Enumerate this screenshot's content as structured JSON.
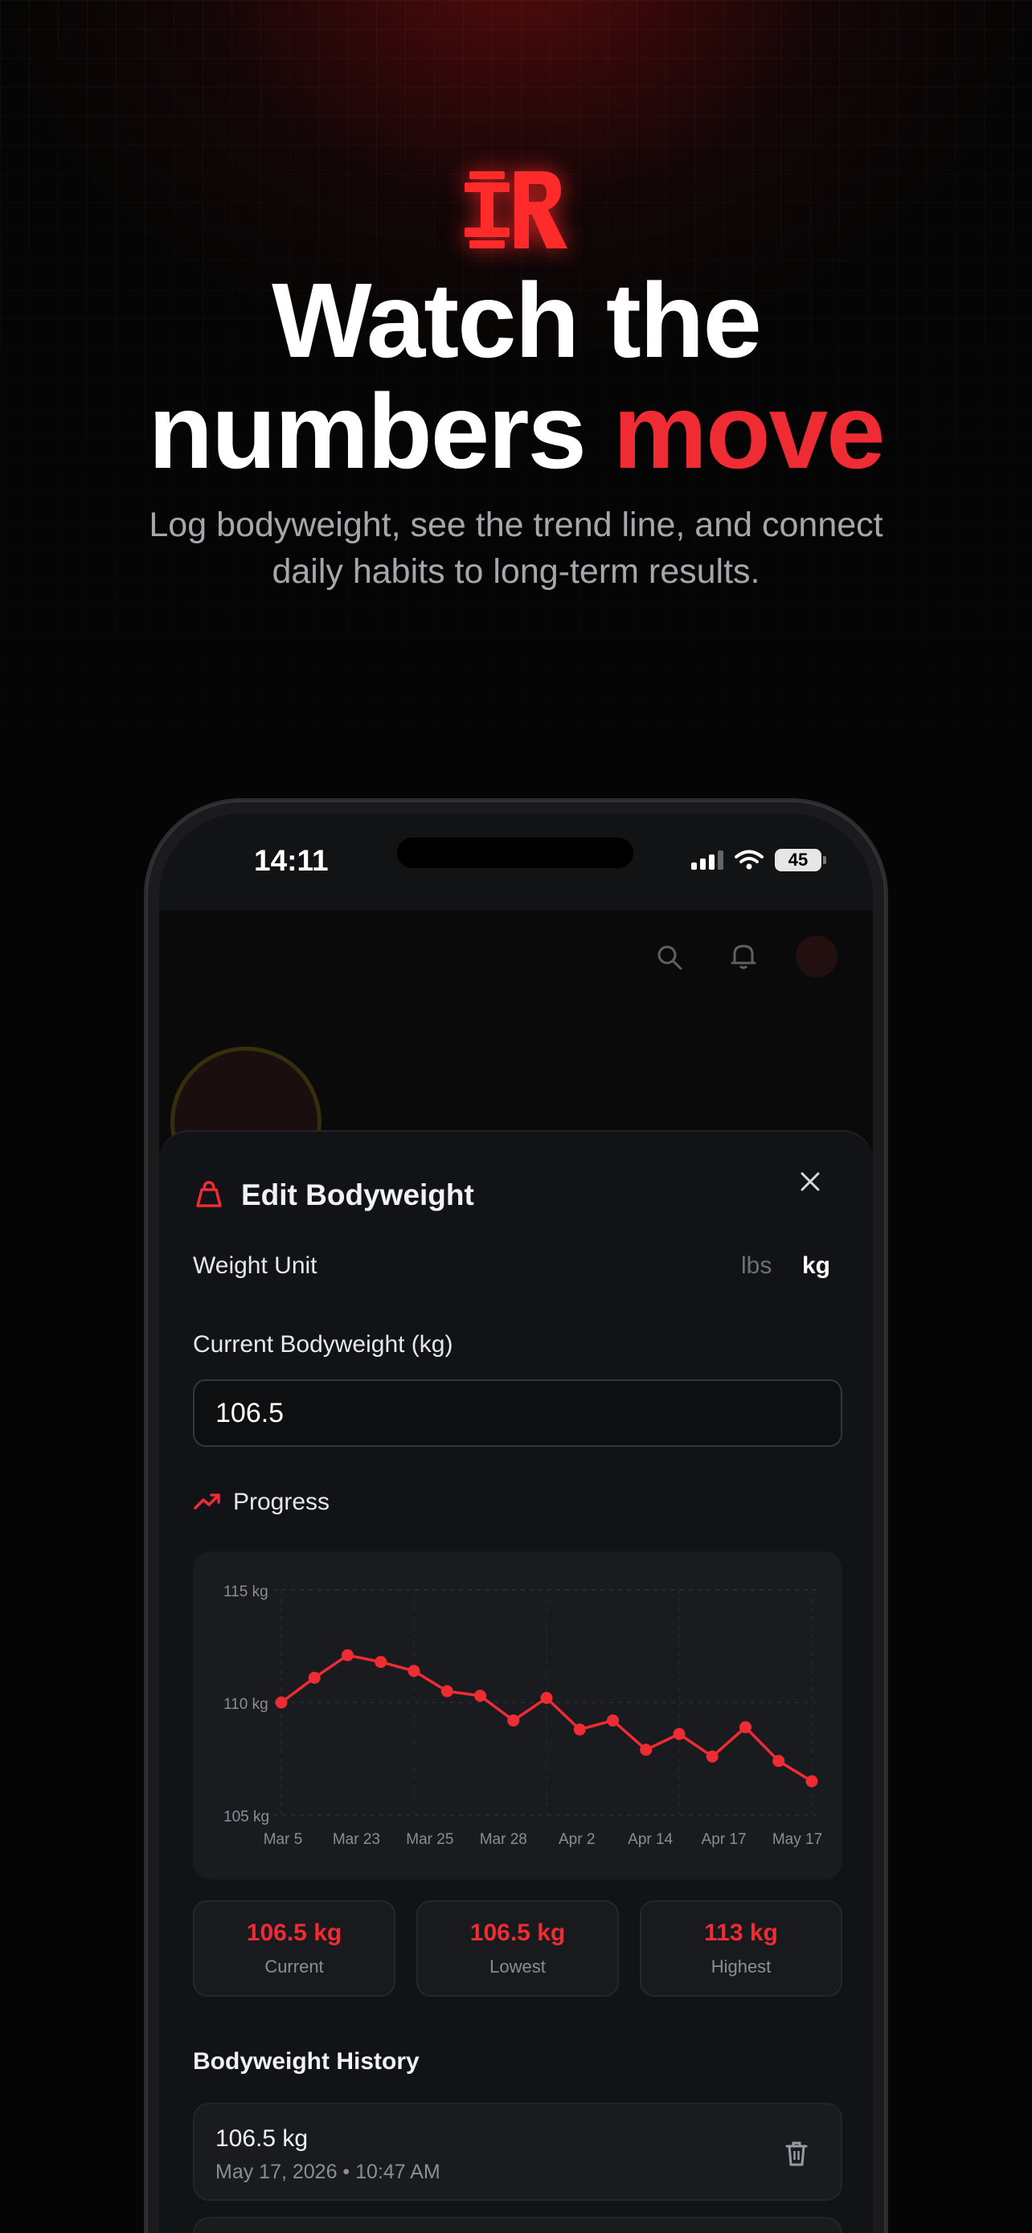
{
  "hero": {
    "title_line1": "Watch the",
    "title_line2_white": "numbers ",
    "title_line2_accent": "move",
    "subtitle_line1": "Log bodyweight, see the trend line, and connect",
    "subtitle_line2": "daily habits to long-term results."
  },
  "status_bar": {
    "time": "14:11",
    "battery": "45"
  },
  "colors": {
    "accent": "#ef2b33",
    "background": "#050505",
    "sheet": "#121316",
    "card": "#1a1b1f",
    "muted": "#8c8d94"
  },
  "icons": [
    "barbell-logo-icon",
    "search-icon",
    "bell-icon",
    "weight-icon",
    "close-icon",
    "trending-up-icon",
    "trash-icon"
  ],
  "sheet": {
    "title": "Edit Bodyweight",
    "weight_unit_label": "Weight Unit",
    "unit_lbs": "lbs",
    "unit_kg": "kg",
    "selected_unit": "kg",
    "current_label": "Current Bodyweight (kg)",
    "current_value": "106.5",
    "progress_label": "Progress"
  },
  "chart_data": {
    "type": "line",
    "title": "",
    "xlabel": "",
    "ylabel": "",
    "ylim": [
      105,
      115
    ],
    "yticks": [
      "115 kg",
      "110 kg",
      "105 kg"
    ],
    "xtick_labels": [
      "Mar 5",
      "Mar 23",
      "Mar 25",
      "Mar 28",
      "Apr 2",
      "Apr 14",
      "Apr 17",
      "May 17"
    ],
    "series": [
      {
        "values": [
          110.0,
          111.1,
          112.1,
          111.8,
          111.4,
          110.5,
          110.3,
          109.2,
          110.2,
          108.8,
          109.2,
          107.9,
          108.6,
          107.6,
          108.9,
          107.4,
          106.5
        ]
      }
    ],
    "grid": true,
    "color": "#ef2b33"
  },
  "stats": [
    {
      "value": "106.5 kg",
      "caption": "Current"
    },
    {
      "value": "106.5 kg",
      "caption": "Lowest"
    },
    {
      "value": "113 kg",
      "caption": "Highest"
    }
  ],
  "history": {
    "title": "Bodyweight History",
    "items": [
      {
        "weight": "106.5 kg",
        "date": "May 17, 2026 • 10:47 AM"
      }
    ]
  }
}
